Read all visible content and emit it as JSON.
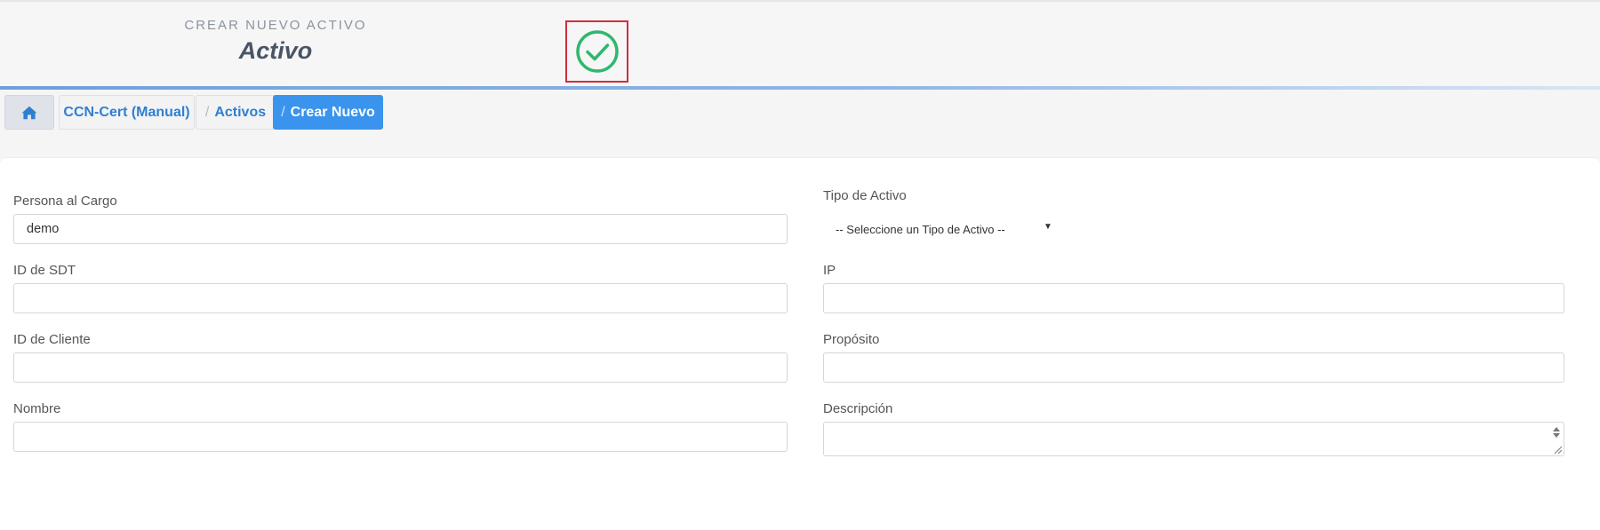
{
  "header": {
    "subtitle": "CREAR NUEVO ACTIVO",
    "title": "Activo",
    "status_icon": "check-circle-icon",
    "status_color": "#2fb86d"
  },
  "breadcrumb": {
    "home_icon": "home-icon",
    "items": [
      {
        "label": "CCN-Cert (Manual)",
        "separator": ""
      },
      {
        "label": "Activos",
        "separator": "/"
      },
      {
        "label": "Crear Nuevo",
        "separator": "/"
      }
    ]
  },
  "form": {
    "persona_label": "Persona al Cargo",
    "persona_value": "demo",
    "tipo_label": "Tipo de Activo",
    "tipo_selected": "-- Seleccione un Tipo de Activo --",
    "sdt_label": "ID de SDT",
    "sdt_value": "",
    "ip_label": "IP",
    "ip_value": "",
    "cliente_label": "ID de Cliente",
    "cliente_value": "",
    "proposito_label": "Propósito",
    "proposito_value": "",
    "nombre_label": "Nombre",
    "nombre_value": "",
    "descripcion_label": "Descripción",
    "descripcion_value": ""
  },
  "colors": {
    "accent": "#3a93ec",
    "link": "#2f7fd1",
    "highlight_border": "#cf2e3b"
  }
}
